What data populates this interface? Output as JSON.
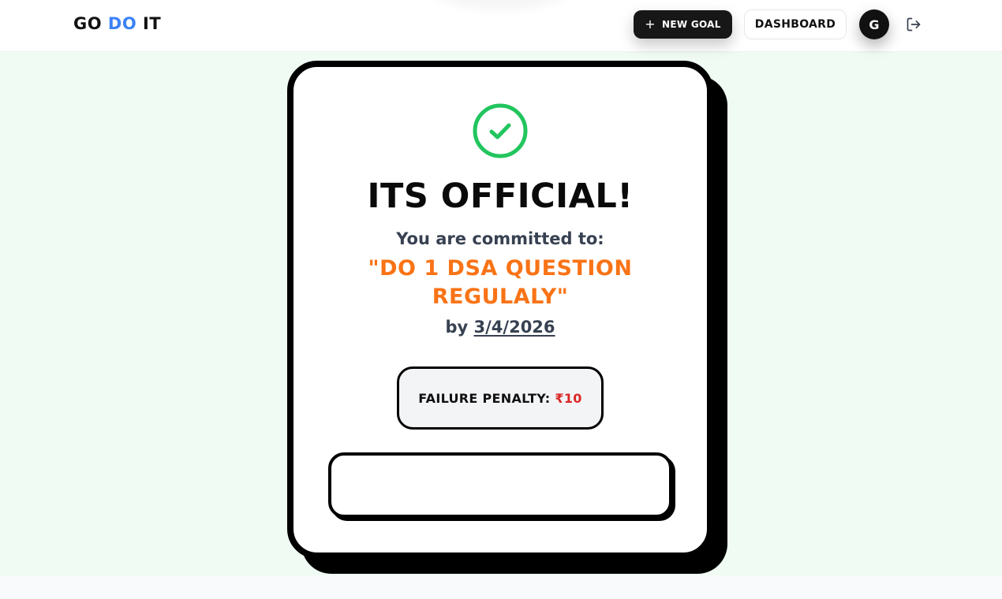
{
  "header": {
    "logo_part1": "GO",
    "logo_part2": "DO",
    "logo_part3": "IT",
    "new_goal_label": "NEW GOAL",
    "dashboard_label": "DASHBOARD",
    "avatar_initial": "G"
  },
  "confirmation": {
    "title": "ITS OFFICIAL!",
    "committed_label": "You are committed to:",
    "goal_text": "\"DO 1 DSA QUESTION REGULALY\"",
    "deadline_prefix": "by",
    "deadline_date": "3/4/2026",
    "penalty_label": "FAILURE PENALTY:",
    "penalty_amount": "₹10"
  },
  "icons": {
    "success": "check-circle-icon",
    "new_goal": "plus-icon",
    "logout": "logout-icon"
  },
  "colors": {
    "accent_blue": "#3b82f6",
    "goal_orange": "#f97316",
    "success_green": "#22c55e",
    "penalty_red": "#dc2626",
    "page_bg_green": "#f0fbf3"
  }
}
